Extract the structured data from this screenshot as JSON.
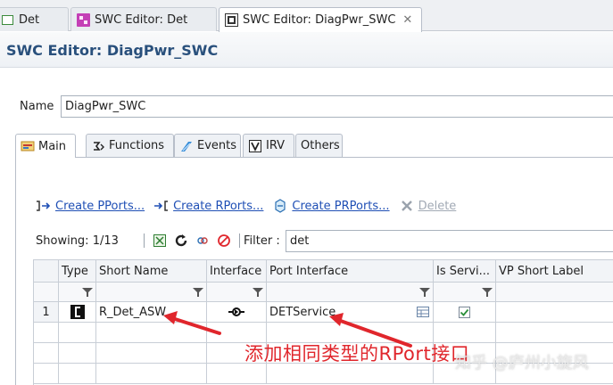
{
  "editor_tabs": [
    {
      "label": "Det",
      "icon": "component-icon"
    },
    {
      "label": "SWC Editor: Det",
      "icon": "swc-editor-icon"
    },
    {
      "label": "SWC Editor: DiagPwr_SWC",
      "icon": "swc-editor-icon",
      "active": true
    }
  ],
  "title": "SWC Editor: DiagPwr_SWC",
  "name_field": {
    "label": "Name",
    "value": "DiagPwr_SWC"
  },
  "page_tabs": [
    {
      "label": "Main",
      "icon": "main-icon",
      "active": true
    },
    {
      "label": "Functions",
      "icon": "functions-icon"
    },
    {
      "label": "Events",
      "icon": "events-icon"
    },
    {
      "label": "IRV",
      "icon": "irv-icon"
    },
    {
      "label": "Others"
    }
  ],
  "actions": {
    "create_pports": "Create PPorts...",
    "create_rports": "Create RPorts...",
    "create_prports": "Create PRPorts...",
    "delete": "Delete"
  },
  "showing": "Showing: 1/13",
  "filter": {
    "label": "Filter :",
    "value": "det"
  },
  "table": {
    "columns": [
      "Type",
      "Short Name",
      "Interface",
      "Port Interface",
      "Is Servi...",
      "VP Short Label"
    ],
    "rows": [
      {
        "num": "1",
        "type_icon": "receiver-port-icon",
        "short_name": "R_Det_ASW",
        "interface_icon": "client-server-icon",
        "port_interface": "DETService",
        "is_service": true,
        "vp_short_label": ""
      }
    ]
  },
  "annotation": "添加相同类型的RPort接口",
  "watermark": "知乎 @庐州小旋风",
  "colors": {
    "title": "#29507c",
    "link": "#1f4fb5",
    "annotation": "#e0262c"
  }
}
